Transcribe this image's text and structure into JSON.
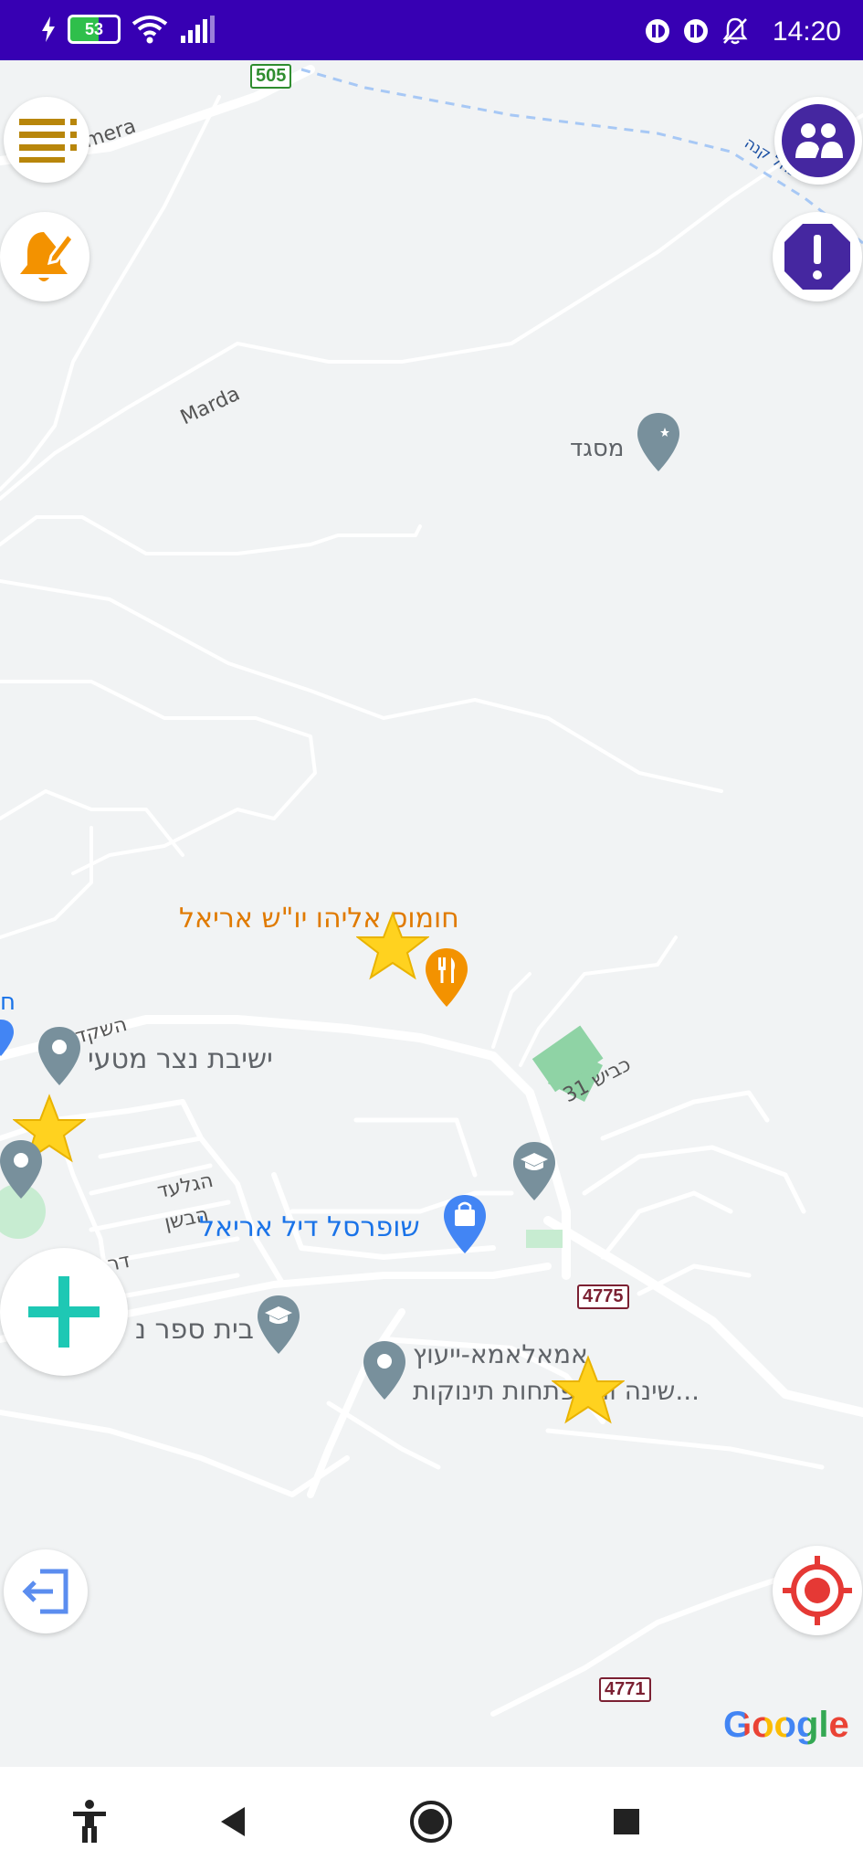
{
  "status_bar": {
    "time": "14:20",
    "battery": "53"
  },
  "map": {
    "road_shields": [
      "505",
      "4775",
      "4771"
    ],
    "labels": {
      "street_mera": "mera",
      "street_marda": "Marda",
      "mosque": "מסגד",
      "restaurant": "חומוס אליהו יו\"ש אריאל",
      "yeshiva": "ישיבת נצר מטעי",
      "street_hashaked": "השקד",
      "street_kvish31": "כביש 31",
      "street_hagilad": "הגלעד",
      "street_habashan": "הבשן",
      "supermarket": "שופרסל דיל אריאל",
      "school": "בית ספר נ",
      "consult_line1": "אמאלאמא-ייעוץ",
      "consult_line2": "שינה והתפתחות תינוקות...",
      "top_right_street": "נחל קנה",
      "left_edge": "ח",
      "street_dr": "דר"
    },
    "logo": "Google"
  },
  "buttons": {
    "menu": "menu-icon",
    "notify": "bell-edit-icon",
    "community": "people-icon",
    "report": "alert-icon",
    "add": "plus-icon",
    "exit": "logout-icon",
    "locate": "target-icon"
  },
  "colors": {
    "status_bar": "#3700b3",
    "menu_icon": "#b8860b",
    "bell": "#f39200",
    "purple": "#4527a0",
    "add": "#1ec8b4",
    "target": "#e53935",
    "exit": "#5b8def",
    "star": "#ffd21f"
  }
}
